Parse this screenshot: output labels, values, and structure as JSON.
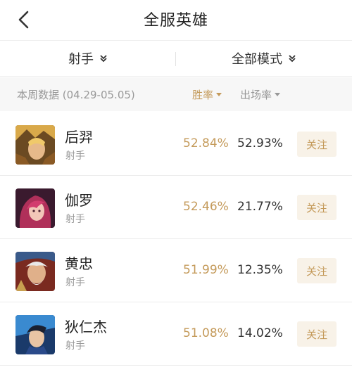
{
  "header": {
    "title": "全服英雄"
  },
  "filters": {
    "role": "射手",
    "mode": "全部模式"
  },
  "subbar": {
    "week_label": "本周数据 (04.29-05.05)",
    "sort_winrate": "胜率",
    "sort_pickrate": "出场率"
  },
  "heroes": [
    {
      "name": "后羿",
      "role": "射手",
      "win_rate": "52.84%",
      "pick_rate": "52.93%",
      "follow": "关注"
    },
    {
      "name": "伽罗",
      "role": "射手",
      "win_rate": "52.46%",
      "pick_rate": "21.77%",
      "follow": "关注"
    },
    {
      "name": "黄忠",
      "role": "射手",
      "win_rate": "51.99%",
      "pick_rate": "12.35%",
      "follow": "关注"
    },
    {
      "name": "狄仁杰",
      "role": "射手",
      "win_rate": "51.08%",
      "pick_rate": "14.02%",
      "follow": "关注"
    }
  ],
  "colors": {
    "accent": "#c49a5a",
    "follow_bg": "#f8f2e8",
    "subbar_bg": "#f7f7f7"
  },
  "icons": {
    "back": "chevron-left-icon",
    "dropdown": "double-chevron-down-icon",
    "sort": "triangle-down-icon"
  }
}
